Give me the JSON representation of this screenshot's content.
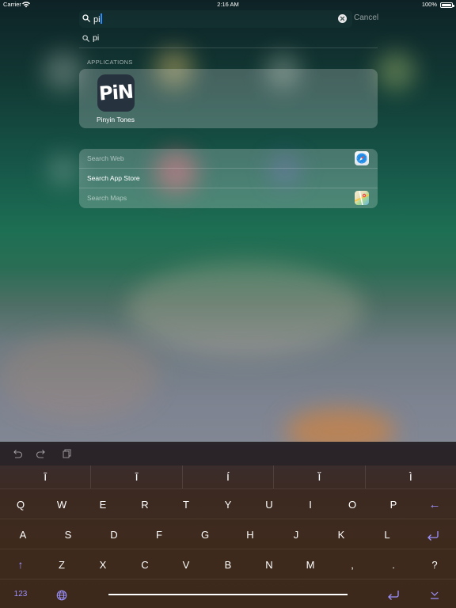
{
  "status_bar": {
    "carrier": "Carrier",
    "time": "2:16 AM",
    "battery": "100%"
  },
  "search": {
    "query": "pi",
    "cancel_label": "Cancel"
  },
  "suggestion": {
    "text": "pi"
  },
  "applications": {
    "header": "APPLICATIONS",
    "apps": [
      {
        "name": "Pinyin Tones",
        "icon_text": "PiN"
      }
    ]
  },
  "actions": [
    {
      "label": "Search Web",
      "icon": "safari-icon"
    },
    {
      "label": "Search App Store",
      "icon": ""
    },
    {
      "label": "Search Maps",
      "icon": "maps-icon"
    }
  ],
  "keyboard": {
    "tone_keys": [
      "ī",
      "ī",
      "í",
      "ǐ",
      "ì"
    ],
    "row1": [
      "Q",
      "W",
      "E",
      "R",
      "T",
      "Y",
      "U",
      "I",
      "O",
      "P"
    ],
    "row2": [
      "A",
      "S",
      "D",
      "F",
      "G",
      "H",
      "J",
      "K",
      "L"
    ],
    "row3": [
      "Z",
      "X",
      "C",
      "V",
      "B",
      "N",
      "M",
      ",",
      ".",
      "?"
    ],
    "numbers_label": "123",
    "backspace_glyph": "←",
    "shift_glyph": "↑",
    "accent_color": "#9d92ff"
  }
}
